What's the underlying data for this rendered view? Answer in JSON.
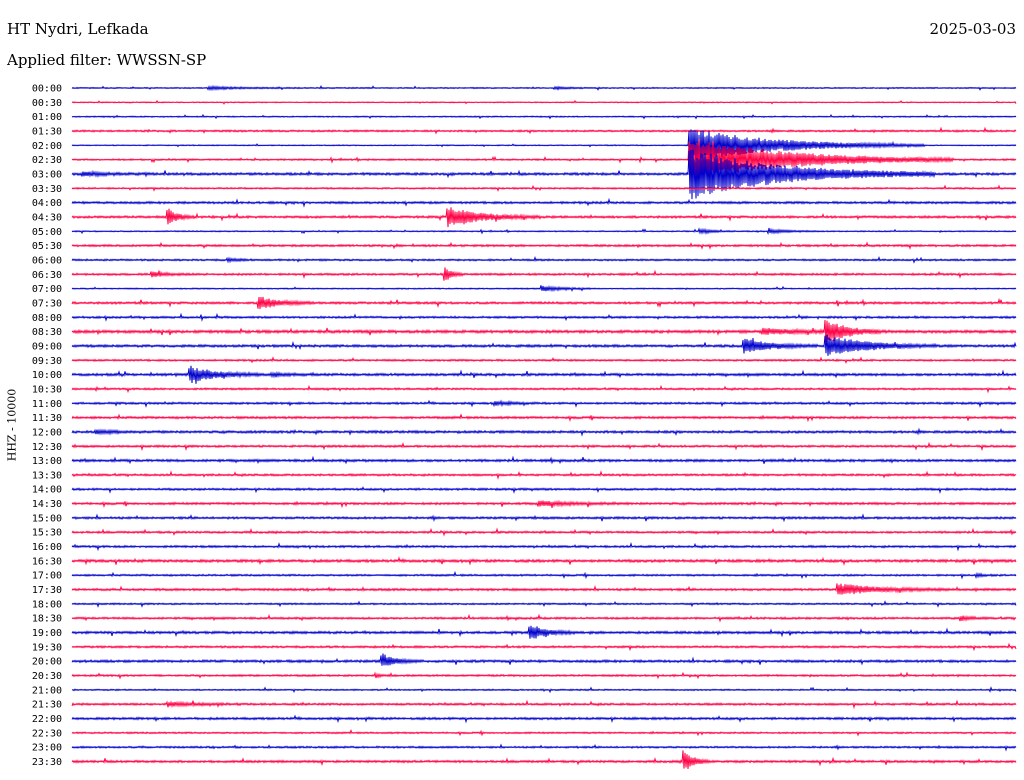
{
  "header": {
    "station": "HT Nydri, Lefkada",
    "filter": "Applied filter: WWSSN-SP",
    "date": "2025-03-03"
  },
  "channel_label": "HHZ - 10000",
  "colors": {
    "blue": "#0000cc",
    "red": "#ff0044",
    "text": "#000000"
  },
  "chart_data": {
    "type": "line",
    "title": "HT Nydri, Lefkada",
    "subtitle": "Applied filter: WWSSN-SP",
    "ylabel": "HHZ - 10000",
    "xlim": [
      0,
      30
    ],
    "x_unit": "minutes",
    "grid": false,
    "ticks": [
      "00:00",
      "00:30",
      "01:00",
      "01:30",
      "02:00",
      "02:30",
      "03:00",
      "03:30",
      "04:00",
      "04:30",
      "05:00",
      "05:30",
      "06:00",
      "06:30",
      "07:00",
      "07:30",
      "08:00",
      "08:30",
      "09:00",
      "09:30",
      "10:00",
      "10:30",
      "11:00",
      "11:30",
      "12:00",
      "12:30",
      "13:00",
      "13:30",
      "14:00",
      "14:30",
      "15:00",
      "15:30",
      "16:00",
      "16:30",
      "17:00",
      "17:30",
      "18:00",
      "18:30",
      "19:00",
      "19:30",
      "20:00",
      "20:30",
      "21:00",
      "21:30",
      "22:00",
      "22:30",
      "23:00",
      "23:30"
    ],
    "trace_colors": [
      "blue",
      "red"
    ],
    "noise": [
      0.6,
      0.5,
      0.6,
      0.9,
      0.5,
      0.8,
      1.2,
      0.8,
      1.1,
      1.1,
      0.6,
      1.0,
      0.9,
      1.0,
      0.6,
      1.1,
      1.0,
      1.4,
      1.2,
      0.9,
      1.2,
      0.9,
      1.0,
      1.1,
      1.2,
      1.0,
      1.2,
      1.0,
      1.0,
      1.1,
      1.1,
      1.0,
      1.0,
      1.3,
      0.9,
      1.1,
      0.8,
      1.0,
      1.2,
      1.0,
      1.2,
      0.9,
      0.7,
      1.0,
      1.1,
      0.8,
      0.9,
      1.1
    ],
    "events": [
      {
        "row": 0,
        "t": 4.3,
        "amp": 1.5,
        "dur": 1.0
      },
      {
        "row": 0,
        "t": 15.3,
        "amp": 1.2,
        "dur": 0.5
      },
      {
        "row": 4,
        "t": 19.6,
        "amp": 18.0,
        "dur": 2.5
      },
      {
        "row": 5,
        "t": 19.6,
        "amp": 24.0,
        "dur": 2.8
      },
      {
        "row": 6,
        "t": 19.6,
        "amp": 26.0,
        "dur": 2.6
      },
      {
        "row": 6,
        "t": 0.3,
        "amp": 2.0,
        "dur": 0.8
      },
      {
        "row": 9,
        "t": 3.0,
        "amp": 10.0,
        "dur": 0.3
      },
      {
        "row": 9,
        "t": 11.9,
        "amp": 11.0,
        "dur": 1.0
      },
      {
        "row": 10,
        "t": 19.9,
        "amp": 2.5,
        "dur": 0.4
      },
      {
        "row": 10,
        "t": 22.1,
        "amp": 2.0,
        "dur": 0.6
      },
      {
        "row": 12,
        "t": 4.9,
        "amp": 2.0,
        "dur": 0.3
      },
      {
        "row": 13,
        "t": 2.5,
        "amp": 3.0,
        "dur": 0.4
      },
      {
        "row": 13,
        "t": 11.8,
        "amp": 11.0,
        "dur": 0.2
      },
      {
        "row": 14,
        "t": 14.9,
        "amp": 3.0,
        "dur": 0.6
      },
      {
        "row": 15,
        "t": 5.9,
        "amp": 7.0,
        "dur": 0.6
      },
      {
        "row": 17,
        "t": 21.9,
        "amp": 2.5,
        "dur": 1.4
      },
      {
        "row": 17,
        "t": 23.9,
        "amp": 14.0,
        "dur": 0.6
      },
      {
        "row": 18,
        "t": 21.3,
        "amp": 8.0,
        "dur": 0.8
      },
      {
        "row": 18,
        "t": 23.9,
        "amp": 12.0,
        "dur": 1.2
      },
      {
        "row": 20,
        "t": 3.7,
        "amp": 9.0,
        "dur": 0.8
      },
      {
        "row": 20,
        "t": 6.3,
        "amp": 1.5,
        "dur": 0.6
      },
      {
        "row": 22,
        "t": 13.4,
        "amp": 2.0,
        "dur": 0.5
      },
      {
        "row": 24,
        "t": 0.7,
        "amp": 2.0,
        "dur": 0.6
      },
      {
        "row": 29,
        "t": 14.8,
        "amp": 2.5,
        "dur": 1.0
      },
      {
        "row": 34,
        "t": 28.7,
        "amp": 2.0,
        "dur": 0.2
      },
      {
        "row": 35,
        "t": 24.3,
        "amp": 6.0,
        "dur": 1.2
      },
      {
        "row": 37,
        "t": 28.2,
        "amp": 3.0,
        "dur": 0.3
      },
      {
        "row": 38,
        "t": 14.5,
        "amp": 8.0,
        "dur": 0.5
      },
      {
        "row": 40,
        "t": 9.8,
        "amp": 8.0,
        "dur": 0.4
      },
      {
        "row": 41,
        "t": 9.6,
        "amp": 2.0,
        "dur": 0.2
      },
      {
        "row": 43,
        "t": 3.0,
        "amp": 2.5,
        "dur": 0.8
      },
      {
        "row": 47,
        "t": 19.4,
        "amp": 12.0,
        "dur": 0.3
      }
    ]
  }
}
